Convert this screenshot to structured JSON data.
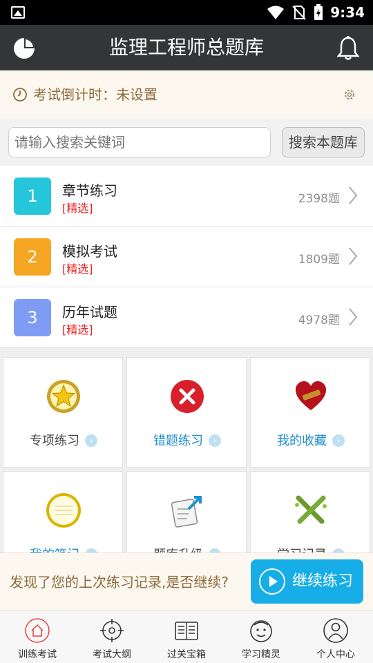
{
  "status_bar": {
    "time": "9:34"
  },
  "app_bar": {
    "title": "监理工程师总题库"
  },
  "countdown": {
    "label": "考试倒计时：未设置"
  },
  "search": {
    "placeholder": "请输入搜索关键词",
    "button_label": "搜索本题库"
  },
  "practice_list": [
    {
      "number": "1",
      "name": "章节练习",
      "tag": "[精选]",
      "count": "2398题",
      "color": "#26c6da"
    },
    {
      "number": "2",
      "name": "模拟考试",
      "tag": "[精选]",
      "count": "1809题",
      "color": "#f5a623"
    },
    {
      "number": "3",
      "name": "历年试题",
      "tag": "[精选]",
      "count": "4978题",
      "color": "#7f9cf5"
    }
  ],
  "feature_grid": [
    {
      "label": "专项练习",
      "icon": "star-medal-icon"
    },
    {
      "label": "错题练习",
      "icon": "red-x-icon"
    },
    {
      "label": "我的收藏",
      "icon": "heart-icon"
    },
    {
      "label": "我的笔记",
      "icon": "notebook-icon"
    },
    {
      "label": "题库升级",
      "icon": "upgrade-icon"
    },
    {
      "label": "学习记录",
      "icon": "crossed-pencils-icon"
    }
  ],
  "resume_prompt": {
    "text": "发现了您的上次练习记录,是否继续?",
    "button_label": "继续练习"
  },
  "tab_bar": [
    {
      "label": "训练考试",
      "icon": "home-icon",
      "active": true
    },
    {
      "label": "考试大纲",
      "icon": "target-icon"
    },
    {
      "label": "过关宝箱",
      "icon": "news-icon"
    },
    {
      "label": "学习精灵",
      "icon": "face-icon"
    },
    {
      "label": "个人中心",
      "icon": "person-icon"
    }
  ],
  "colors": {
    "app_bar": "#333536",
    "accent_blue": "#17aee8",
    "tag_red": "#e22222",
    "tab_active": "#e8413c"
  }
}
